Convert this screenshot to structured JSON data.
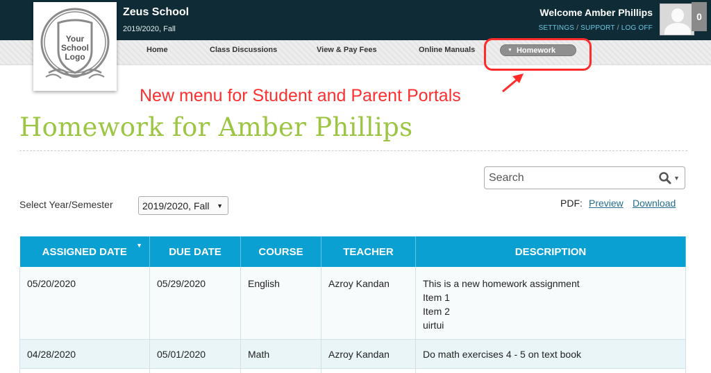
{
  "header": {
    "school_name": "Zeus School",
    "term": "2019/2020, Fall",
    "welcome": "Welcome Amber Phillips",
    "links": [
      "SETTINGS",
      "SUPPORT",
      "LOG OFF"
    ],
    "notification_count": "0",
    "logo_text": [
      "Your",
      "School",
      "Logo"
    ]
  },
  "nav": {
    "items": [
      "Home",
      "Class Discussions",
      "View & Pay Fees",
      "Online Manuals"
    ],
    "active": "Homework"
  },
  "annotation": {
    "text": "New menu for Student and Parent Portals",
    "color": "#ff2a2a"
  },
  "page": {
    "title": "Homework for Amber Phillips",
    "title_color": "#9cc642"
  },
  "search": {
    "placeholder": "Search"
  },
  "filter": {
    "label": "Select Year/Semester",
    "selected": "2019/2020, Fall"
  },
  "pdf": {
    "label": "PDF:",
    "preview": "Preview",
    "download": "Download"
  },
  "table": {
    "header_color": "#0aa0d2",
    "columns": [
      "ASSIGNED DATE",
      "DUE DATE",
      "COURSE",
      "TEACHER",
      "DESCRIPTION"
    ],
    "rows": [
      {
        "assigned": "05/20/2020",
        "due": "05/29/2020",
        "course": "English",
        "teacher": "Azroy Kandan",
        "description": [
          "This is a new homework assignment",
          "Item 1",
          "Item 2",
          "uirtui"
        ]
      },
      {
        "assigned": "04/28/2020",
        "due": "05/01/2020",
        "course": "Math",
        "teacher": "Azroy Kandan",
        "description": [
          "Do math exercises 4 - 5 on text book"
        ]
      }
    ]
  }
}
